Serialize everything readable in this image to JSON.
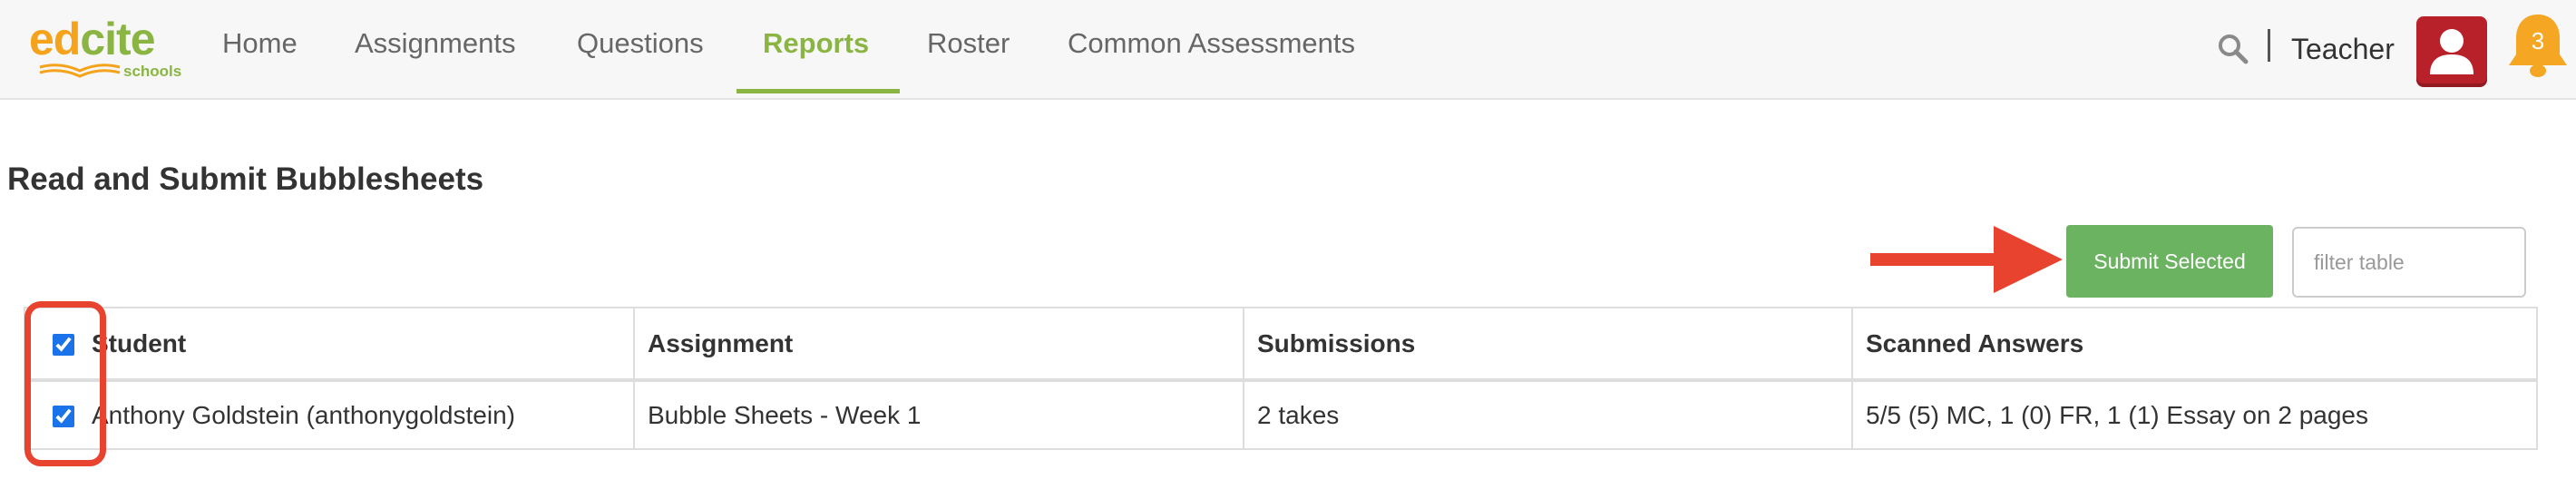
{
  "logo": {
    "main_part1": "ed",
    "main_part2": "cite",
    "sub": "schools"
  },
  "nav": {
    "items": [
      {
        "label": "Home",
        "active": false
      },
      {
        "label": "Assignments",
        "active": false
      },
      {
        "label": "Questions",
        "active": false
      },
      {
        "label": "Reports",
        "active": true
      },
      {
        "label": "Roster",
        "active": false
      },
      {
        "label": "Common Assessments",
        "active": false
      }
    ],
    "search_icon": "search-icon",
    "user_label": "Teacher",
    "avatar_icon": "user-icon",
    "notifications": {
      "icon": "bell-icon",
      "count": "3"
    }
  },
  "page": {
    "title": "Read and Submit Bubblesheets"
  },
  "toolbar": {
    "submit_label": "Submit Selected",
    "filter_placeholder": "filter table",
    "filter_value": ""
  },
  "table": {
    "select_all_checked": true,
    "columns": [
      "Student",
      "Assignment",
      "Submissions",
      "Scanned Answers"
    ],
    "rows": [
      {
        "checked": true,
        "student": "Anthony Goldstein (anthonygoldstein)",
        "assignment": "Bubble Sheets - Week 1",
        "submissions": "2 takes",
        "scanned_answers": "5/5 (5) MC, 1 (0) FR, 1 (1) Essay on 2 pages"
      }
    ]
  },
  "colors": {
    "brand_green": "#8ab542",
    "brand_orange": "#f4a31b",
    "submit_green": "#6cb361",
    "annotation_red": "#e8432e",
    "avatar_red": "#b8212a",
    "bell_orange": "#f5a623"
  }
}
